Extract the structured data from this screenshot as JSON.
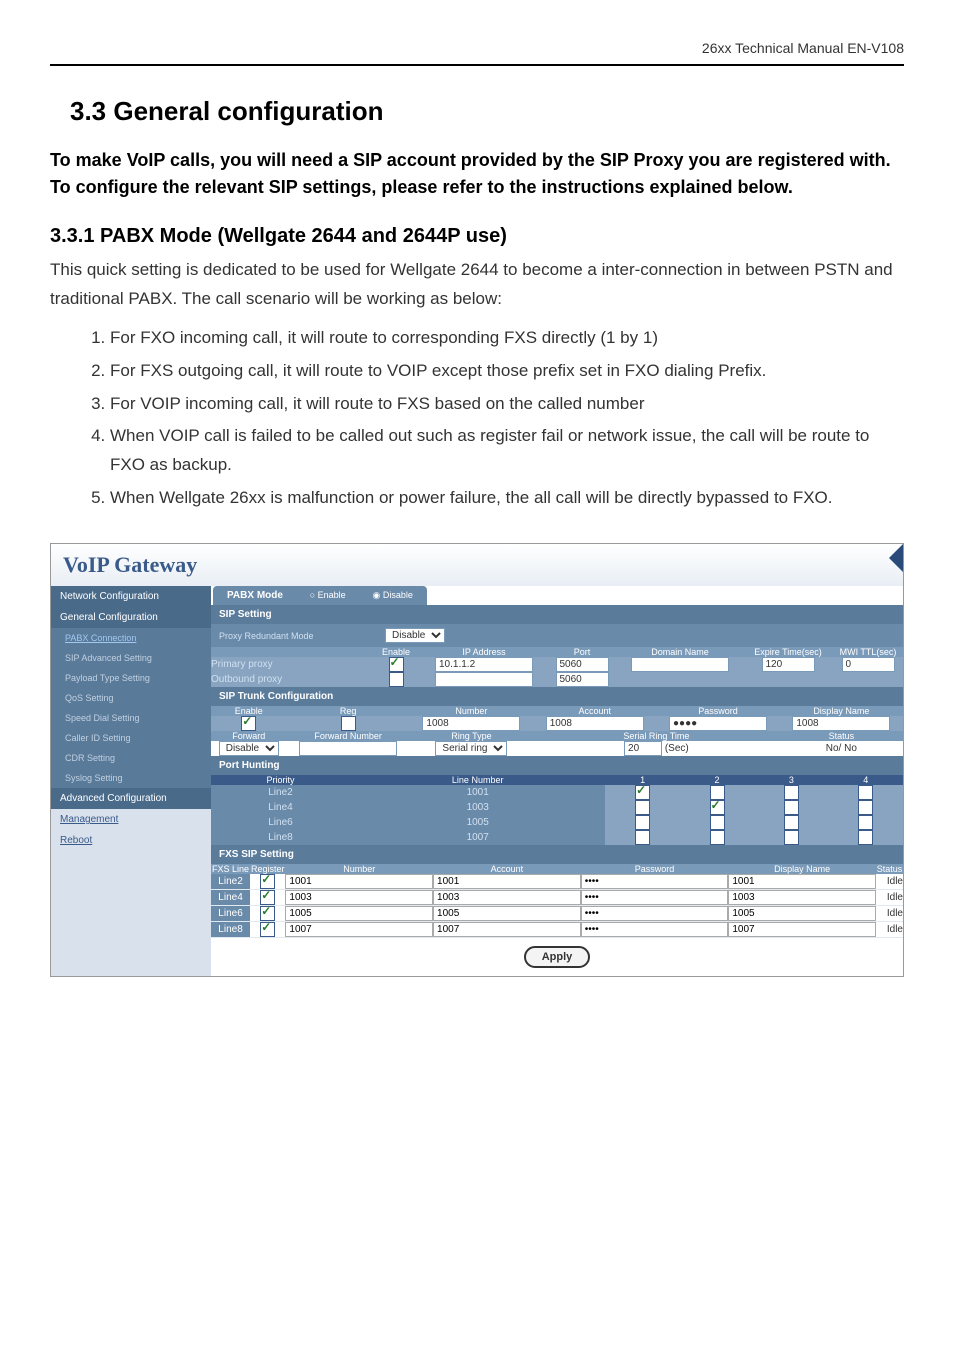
{
  "header": "26xx Technical Manual EN-V108",
  "section_title": "3.3 General configuration",
  "intro": "To make VoIP calls, you will need a SIP account provided by the SIP Proxy you are registered with.   To configure the relevant SIP settings, please refer to the instructions explained below.",
  "subsection_title": "3.3.1 PABX Mode (Wellgate 2644 and 2644P use)",
  "body_text": "This quick setting is dedicated to be used for Wellgate 2644 to become a inter-connection in between PSTN and traditional PABX. The call scenario will be working as below:",
  "list": [
    "For FXO incoming call, it will route to corresponding FXS directly (1 by 1)",
    "For FXS outgoing call, it will route to VOIP except those prefix set in FXO dialing Prefix.",
    "For VOIP incoming call, it will route to FXS based on the called number",
    "When VOIP call is failed to be called out such as register fail or network issue, the call will be route to FXO as backup.",
    "When Wellgate 26xx is malfunction or power failure, the all call will be directly bypassed to FXO."
  ],
  "voip_title": "VoIP  Gateway",
  "sidebar": {
    "network_config": "Network Configuration",
    "general_config": "General Configuration",
    "pabx_connection": "PABX Connection",
    "sip_advanced": "SIP Advanced Setting",
    "payload_type": "Payload Type Setting",
    "qos": "QoS Setting",
    "speed_dial": "Speed Dial Setting",
    "caller_id": "Caller ID Setting",
    "cdr": "CDR Setting",
    "syslog": "Syslog Setting",
    "advanced_config": "Advanced Configuration",
    "management": "Management",
    "reboot": "Reboot"
  },
  "pabx_tab": "PABX Mode",
  "pabx_enable": "Enable",
  "pabx_disable": "Disable",
  "sip_setting": "SIP Setting",
  "proxy_redundant": "Proxy Redundant Mode",
  "proxy_redundant_value": "Disable",
  "headers": {
    "enable": "Enable",
    "ip_address": "IP Address",
    "port": "Port",
    "domain_name": "Domain Name",
    "expire_time": "Expire Time(sec)",
    "mwi_ttl": "MWI TTL(sec)"
  },
  "primary_proxy": "Primary proxy",
  "outbound_proxy": "Outbound proxy",
  "primary_ip": "10.1.1.2",
  "primary_port": "5060",
  "outbound_port": "5060",
  "expire_val": "120",
  "mwi_val": "0",
  "sip_trunk_config": "SIP Trunk Configuration",
  "trunk_headers": {
    "enable": "Enable",
    "reg": "Reg",
    "number": "Number",
    "account": "Account",
    "password": "Password",
    "display_name": "Display Name"
  },
  "trunk_number": "1008",
  "trunk_account": "1008",
  "trunk_password": "●●●●",
  "trunk_display": "1008",
  "trunk_row2": {
    "forward": "Forward",
    "forward_number": "Forward Number",
    "ring_type": "Ring Type",
    "serial_ring_time": "Serial Ring Time",
    "status": "Status"
  },
  "forward_value": "Disable",
  "ring_type_value": "Serial ring",
  "serial_ring_val": "20",
  "sec_label": "(Sec)",
  "status_val": "No/ No",
  "port_hunting": "Port Hunting",
  "port_th": {
    "priority": "Priority",
    "line_number": "Line Number",
    "c1": "1",
    "c2": "2",
    "c3": "3",
    "c4": "4"
  },
  "port_rows": [
    {
      "label": "Line2",
      "num": "1001"
    },
    {
      "label": "Line4",
      "num": "1003"
    },
    {
      "label": "Line6",
      "num": "1005"
    },
    {
      "label": "Line8",
      "num": "1007"
    }
  ],
  "fxs_sip_setting": "FXS SIP Setting",
  "fxs_headers": {
    "fxs_line": "FXS Line",
    "register": "Register",
    "number": "Number",
    "account": "Account",
    "password": "Password",
    "display_name": "Display Name",
    "status": "Status"
  },
  "fxs_rows": [
    {
      "label": "Line2",
      "num": "1001",
      "acct": "1001",
      "disp": "1001",
      "status": "Idle"
    },
    {
      "label": "Line4",
      "num": "1003",
      "acct": "1003",
      "disp": "1003",
      "status": "Idle"
    },
    {
      "label": "Line6",
      "num": "1005",
      "acct": "1005",
      "disp": "1005",
      "status": "Idle"
    },
    {
      "label": "Line8",
      "num": "1007",
      "acct": "1007",
      "disp": "1007",
      "status": "Idle"
    }
  ],
  "apply": "Apply"
}
